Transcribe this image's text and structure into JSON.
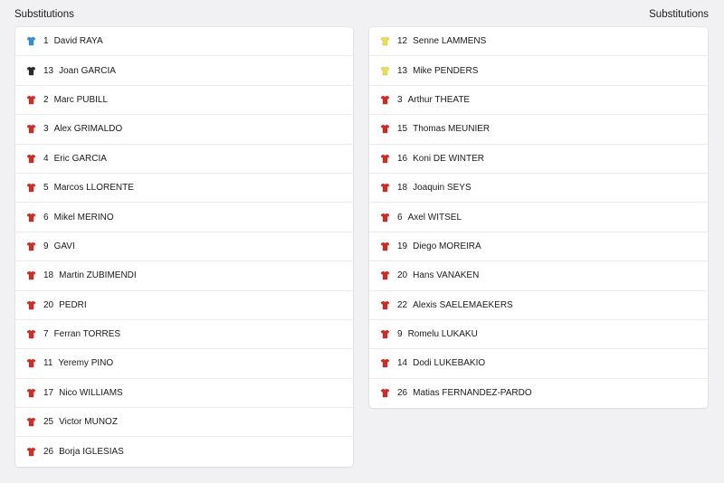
{
  "left": {
    "title": "Substitutions",
    "players": [
      {
        "number": "1",
        "name": "David RAYA",
        "kit": "keeper-blue"
      },
      {
        "number": "13",
        "name": "Joan GARCIA",
        "kit": "keeper-black"
      },
      {
        "number": "2",
        "name": "Marc PUBILL",
        "kit": "outfield-red"
      },
      {
        "number": "3",
        "name": "Alex GRIMALDO",
        "kit": "outfield-red"
      },
      {
        "number": "4",
        "name": "Eric GARCIA",
        "kit": "outfield-red"
      },
      {
        "number": "5",
        "name": "Marcos LLORENTE",
        "kit": "outfield-red"
      },
      {
        "number": "6",
        "name": "Mikel MERINO",
        "kit": "outfield-red"
      },
      {
        "number": "9",
        "name": "GAVI",
        "kit": "outfield-red"
      },
      {
        "number": "18",
        "name": "Martin ZUBIMENDI",
        "kit": "outfield-red"
      },
      {
        "number": "20",
        "name": "PEDRI",
        "kit": "outfield-red"
      },
      {
        "number": "7",
        "name": "Ferran TORRES",
        "kit": "outfield-red"
      },
      {
        "number": "11",
        "name": "Yeremy PINO",
        "kit": "outfield-red"
      },
      {
        "number": "17",
        "name": "Nico WILLIAMS",
        "kit": "outfield-red"
      },
      {
        "number": "25",
        "name": "Victor MUNOZ",
        "kit": "outfield-red"
      },
      {
        "number": "26",
        "name": "Borja IGLESIAS",
        "kit": "outfield-red"
      }
    ]
  },
  "right": {
    "title": "Substitutions",
    "players": [
      {
        "number": "12",
        "name": "Senne LAMMENS",
        "kit": "keeper-yellow"
      },
      {
        "number": "13",
        "name": "Mike PENDERS",
        "kit": "keeper-yellow"
      },
      {
        "number": "3",
        "name": "Arthur THEATE",
        "kit": "outfield-red"
      },
      {
        "number": "15",
        "name": "Thomas MEUNIER",
        "kit": "outfield-red"
      },
      {
        "number": "16",
        "name": "Koni DE WINTER",
        "kit": "outfield-red"
      },
      {
        "number": "18",
        "name": "Joaquin SEYS",
        "kit": "outfield-red"
      },
      {
        "number": "6",
        "name": "Axel WITSEL",
        "kit": "outfield-red"
      },
      {
        "number": "19",
        "name": "Diego MOREIRA",
        "kit": "outfield-red"
      },
      {
        "number": "20",
        "name": "Hans VANAKEN",
        "kit": "outfield-red"
      },
      {
        "number": "22",
        "name": "Alexis SAELEMAEKERS",
        "kit": "outfield-red"
      },
      {
        "number": "9",
        "name": "Romelu LUKAKU",
        "kit": "outfield-red"
      },
      {
        "number": "14",
        "name": "Dodi LUKEBAKIO",
        "kit": "outfield-red"
      },
      {
        "number": "26",
        "name": "Matias FERNANDEZ-PARDO",
        "kit": "outfield-red"
      }
    ]
  },
  "kit_colors": {
    "keeper-blue": "#2e8fd6",
    "keeper-black": "#2a2a2a",
    "keeper-yellow": "#e8e04a",
    "outfield-red": "#d42a22"
  }
}
